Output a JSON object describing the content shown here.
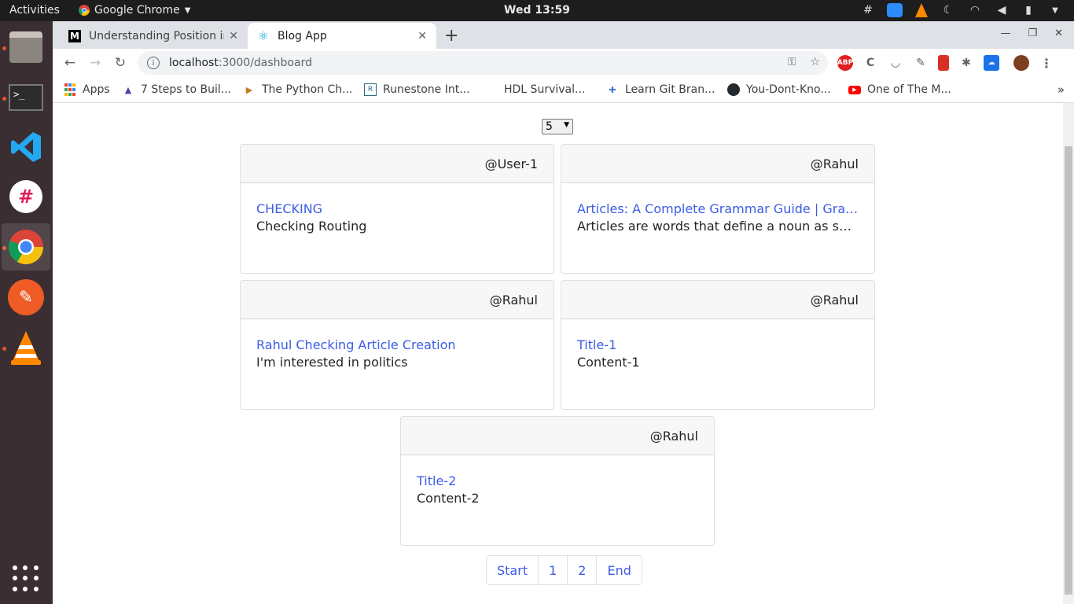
{
  "topbar": {
    "activities": "Activities",
    "app_name": "Google Chrome",
    "clock": "Wed 13:59"
  },
  "browser": {
    "tabs": [
      {
        "title": "Understanding Position in",
        "favicon": "medium-icon"
      },
      {
        "title": "Blog App",
        "favicon": "react-icon"
      }
    ],
    "url_host": "localhost",
    "url_path": ":3000/dashboard",
    "bookmarks": [
      {
        "label": "Apps",
        "icon": "apps-grid-icon"
      },
      {
        "label": "7 Steps to Buil...",
        "icon": "bookmark-icon"
      },
      {
        "label": "The Python Ch...",
        "icon": "python-icon"
      },
      {
        "label": "Runestone Int...",
        "icon": "runestone-icon"
      },
      {
        "label": "HDL Survival...",
        "icon": "none"
      },
      {
        "label": "Learn Git Bran...",
        "icon": "git-icon"
      },
      {
        "label": "You-Dont-Kno...",
        "icon": "github-icon"
      },
      {
        "label": "One of The M...",
        "icon": "youtube-icon"
      }
    ]
  },
  "page": {
    "posts_per_page": "5",
    "cards": [
      {
        "author": "@User-1",
        "title": "CHECKING",
        "content": "Checking Routing"
      },
      {
        "author": "@Rahul",
        "title": "Articles: A Complete Grammar Guide | Grammarly",
        "content": "Articles are words that define a noun as specific or unspecific."
      },
      {
        "author": "@Rahul",
        "title": "Rahul Checking Article Creation",
        "content": "I'm interested in politics"
      },
      {
        "author": "@Rahul",
        "title": "Title-1",
        "content": "Content-1"
      },
      {
        "author": "@Rahul",
        "title": "Title-2",
        "content": "Content-2"
      }
    ],
    "pagination": [
      "Start",
      "1",
      "2",
      "End"
    ]
  },
  "colors": {
    "link": "#3c5ce6",
    "topbar": "#1d1d1d",
    "dock": "#3a2e33"
  }
}
